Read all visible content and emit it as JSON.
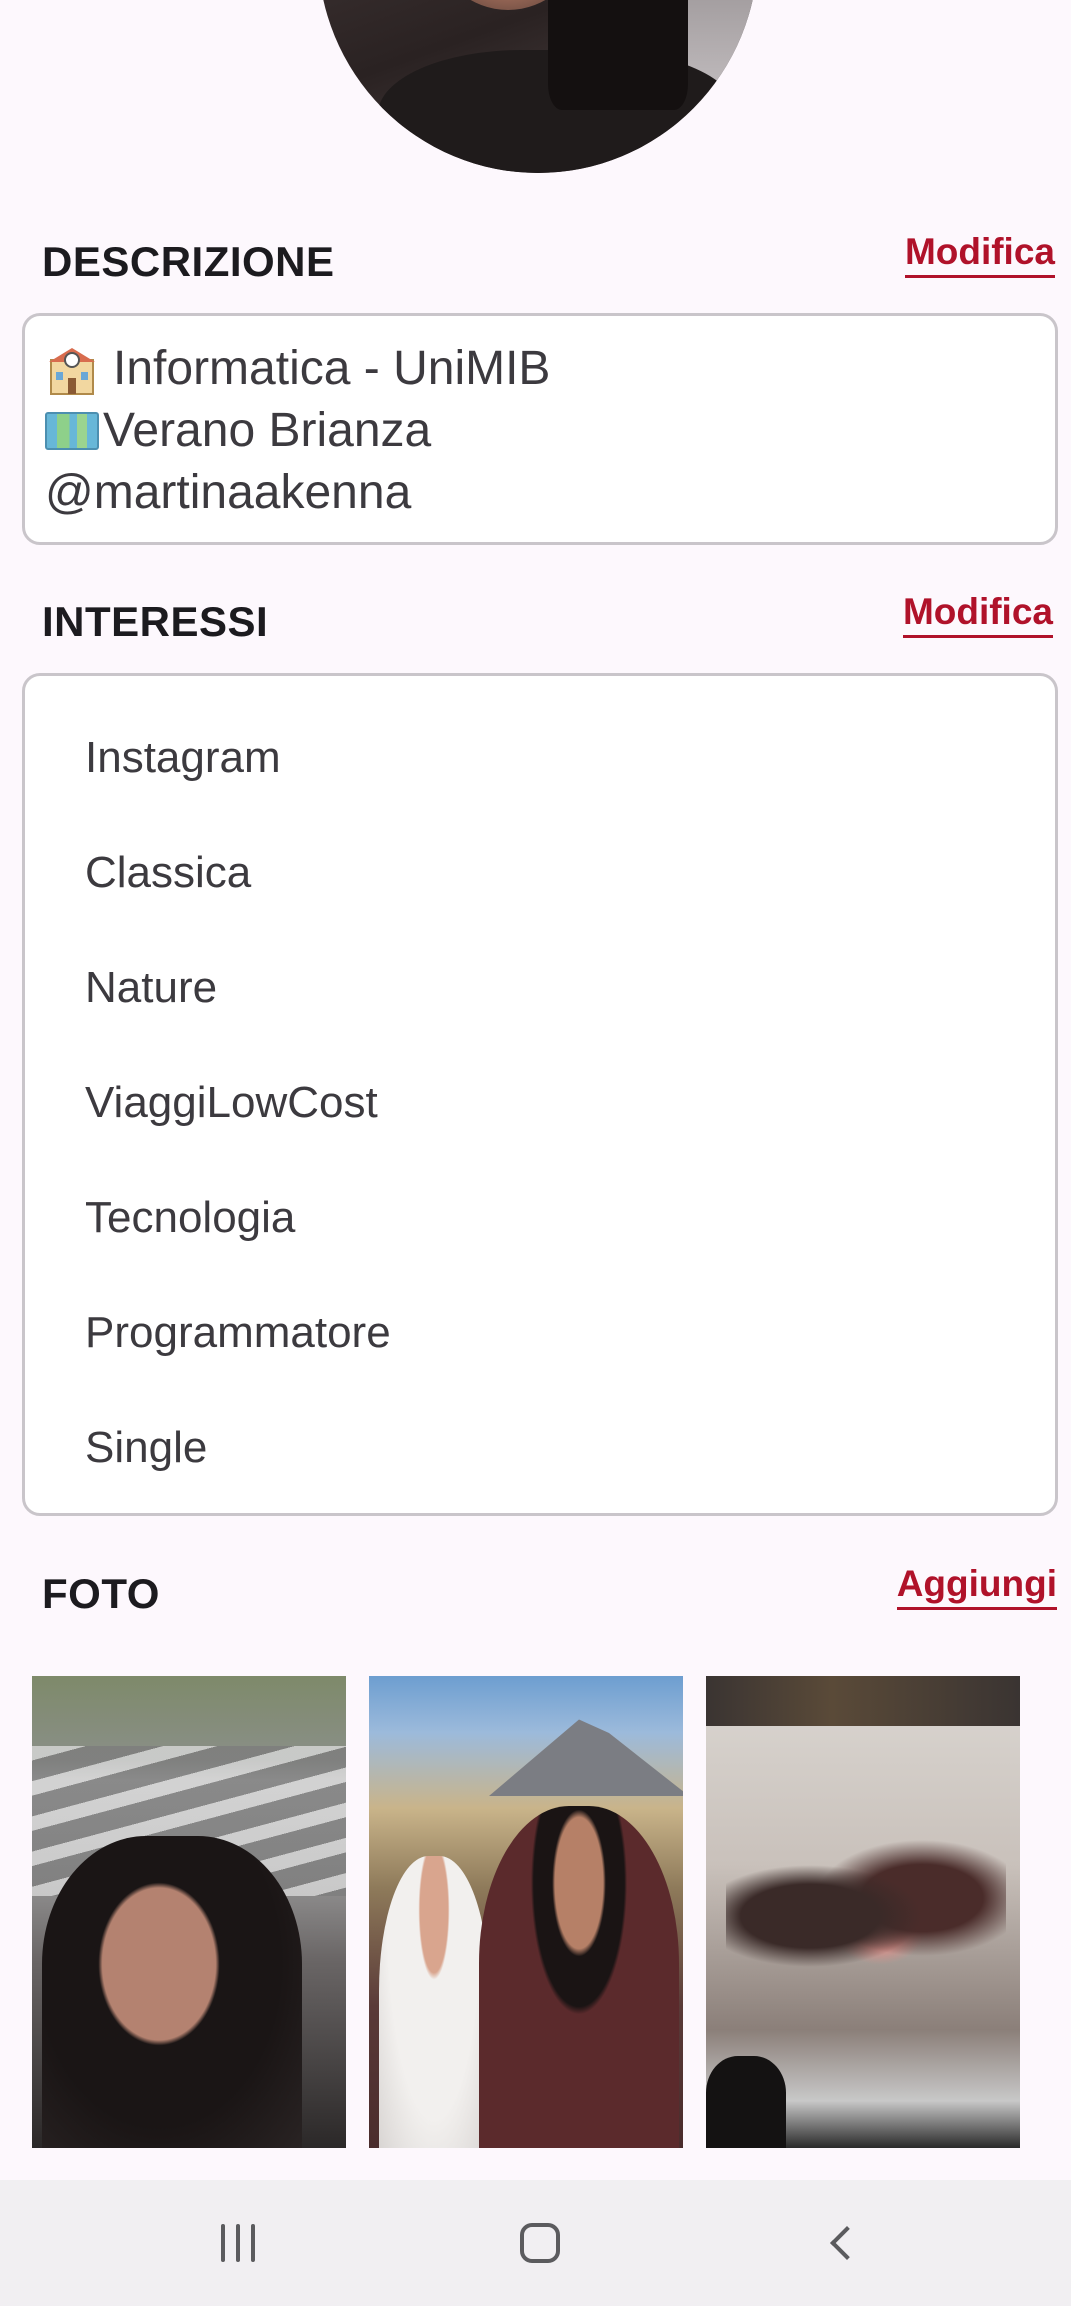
{
  "description": {
    "title": "DESCRIZIONE",
    "edit_label": "Modifica",
    "lines": [
      {
        "emoji": "school-building-icon",
        "text": "Informatica - UniMIB"
      },
      {
        "emoji": "world-map-icon",
        "text": "Verano Brianza"
      },
      {
        "emoji": "",
        "text": "@martinaakenna"
      }
    ]
  },
  "interests": {
    "title": "INTERESSI",
    "edit_label": "Modifica",
    "items": [
      "Instagram",
      "Classica",
      "Nature",
      "ViaggiLowCost",
      "Tecnologia",
      "Programmatore",
      "Single"
    ]
  },
  "photos": {
    "title": "FOTO",
    "add_label": "Aggiungi",
    "count": 3
  },
  "colors": {
    "accent": "#b0122a",
    "background": "#fdf8fd",
    "border": "#c9c5ca",
    "navbar": "#f1eff2"
  },
  "navbar": {
    "recent_icon": "recent-apps-icon",
    "home_icon": "home-icon",
    "back_icon": "back-icon"
  }
}
